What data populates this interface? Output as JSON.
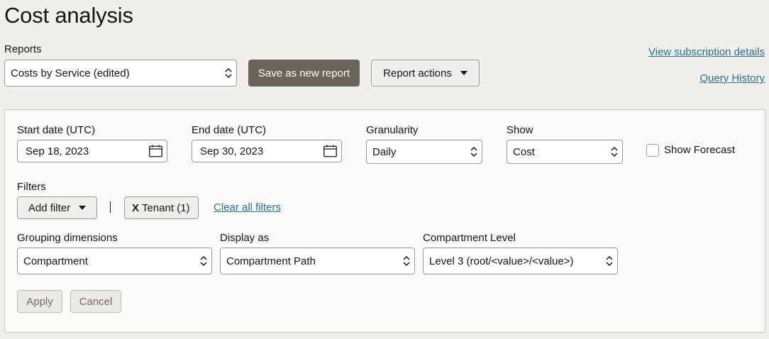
{
  "page": {
    "title": "Cost analysis"
  },
  "reports": {
    "label": "Reports",
    "selected": "Costs by Service (edited)",
    "save_label": "Save as new report",
    "actions_label": "Report actions"
  },
  "links": {
    "subscription": "View subscription details",
    "query_history": "Query History"
  },
  "filters_panel": {
    "start_date": {
      "label": "Start date (UTC)",
      "value": "Sep 18, 2023"
    },
    "end_date": {
      "label": "End date (UTC)",
      "value": "Sep 30, 2023"
    },
    "granularity": {
      "label": "Granularity",
      "value": "Daily"
    },
    "show": {
      "label": "Show",
      "value": "Cost"
    },
    "forecast": {
      "label": "Show Forecast",
      "checked": false
    },
    "filters": {
      "label": "Filters",
      "add_label": "Add filter",
      "chip_close": "X",
      "chip_label": "Tenant (1)",
      "clear_label": "Clear all filters"
    },
    "grouping": {
      "label": "Grouping dimensions",
      "value": "Compartment"
    },
    "display_as": {
      "label": "Display as",
      "value": "Compartment Path"
    },
    "compartment_level": {
      "label": "Compartment Level",
      "value": "Level 3 (root/<value>/<value>)"
    },
    "apply_label": "Apply",
    "cancel_label": "Cancel"
  }
}
